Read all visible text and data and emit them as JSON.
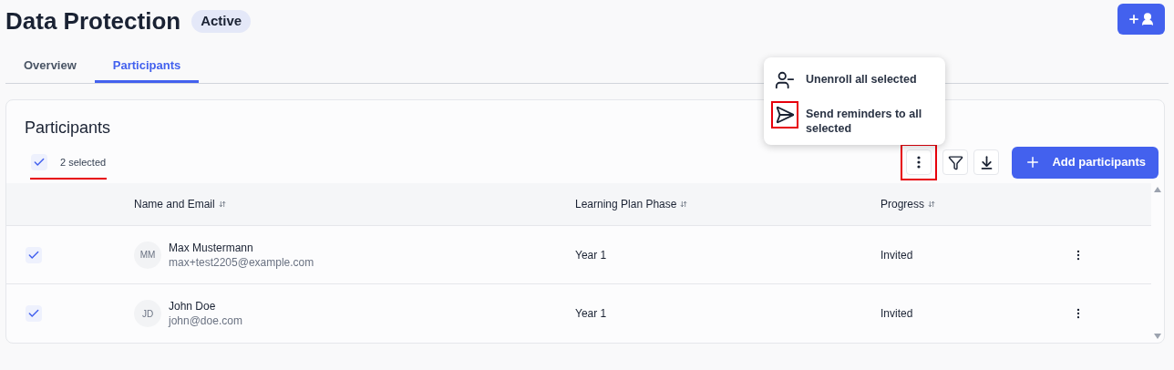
{
  "header": {
    "title": "Data Protection",
    "status": "Active"
  },
  "tabs": [
    {
      "label": "Overview",
      "selected": false
    },
    {
      "label": "Participants",
      "selected": true
    }
  ],
  "card": {
    "title": "Participants",
    "selection": {
      "checked": true,
      "label": "2 selected"
    },
    "add_button": "Add participants"
  },
  "menu": {
    "items": [
      {
        "kind": "unenroll",
        "label": "Unenroll all selected"
      },
      {
        "kind": "send",
        "label": "Send reminders to all selected"
      }
    ]
  },
  "table": {
    "columns": [
      "Name and Email",
      "Learning Plan Phase",
      "Progress"
    ],
    "rows": [
      {
        "checked": true,
        "initials": "MM",
        "name": "Max Mustermann",
        "email": "max+test2205@example.com",
        "phase": "Year 1",
        "progress": "Invited"
      },
      {
        "checked": true,
        "initials": "JD",
        "name": "John Doe",
        "email": "john@doe.com",
        "phase": "Year 1",
        "progress": "Invited"
      }
    ]
  }
}
